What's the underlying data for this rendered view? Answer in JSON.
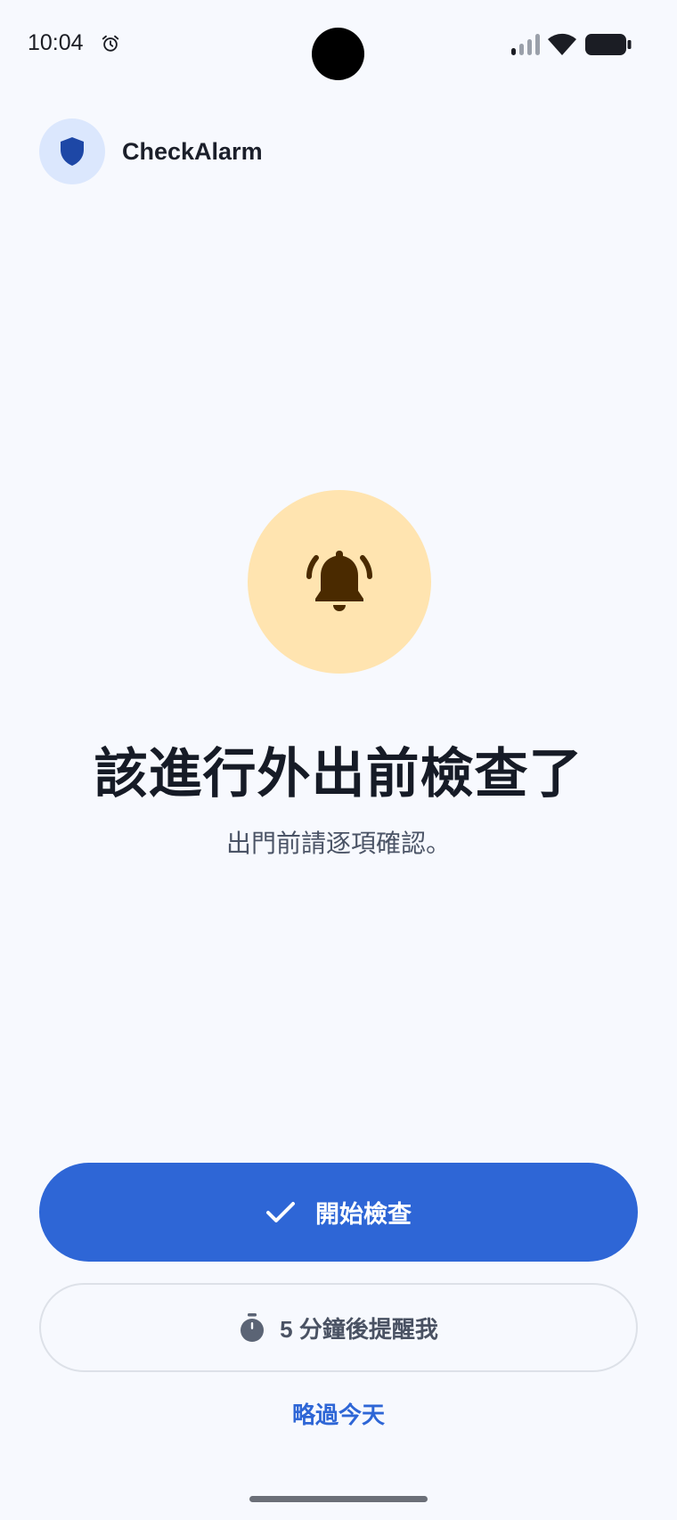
{
  "status_bar": {
    "time": "10:04",
    "alarm_icon": "alarm-clock-icon",
    "signal_icon": "cellular-signal-icon",
    "wifi_icon": "wifi-icon",
    "battery_icon": "battery-icon"
  },
  "header": {
    "app_name": "CheckAlarm",
    "logo_icon": "shield-icon",
    "logo_bg_color": "#dbe7fd",
    "logo_color": "#1d47a6"
  },
  "hero": {
    "icon": "ringing-bell-icon",
    "icon_bg_color": "#ffe4b0",
    "icon_color": "#4a2a00",
    "title": "該進行外出前檢查了",
    "subtitle": "出門前請逐項確認。"
  },
  "actions": {
    "start_check": {
      "label": "開始檢查",
      "icon": "check-icon",
      "color": "#2e66d6"
    },
    "snooze": {
      "label": "5 分鐘後提醒我",
      "icon": "stopwatch-icon"
    },
    "skip": {
      "label": "略過今天"
    }
  }
}
